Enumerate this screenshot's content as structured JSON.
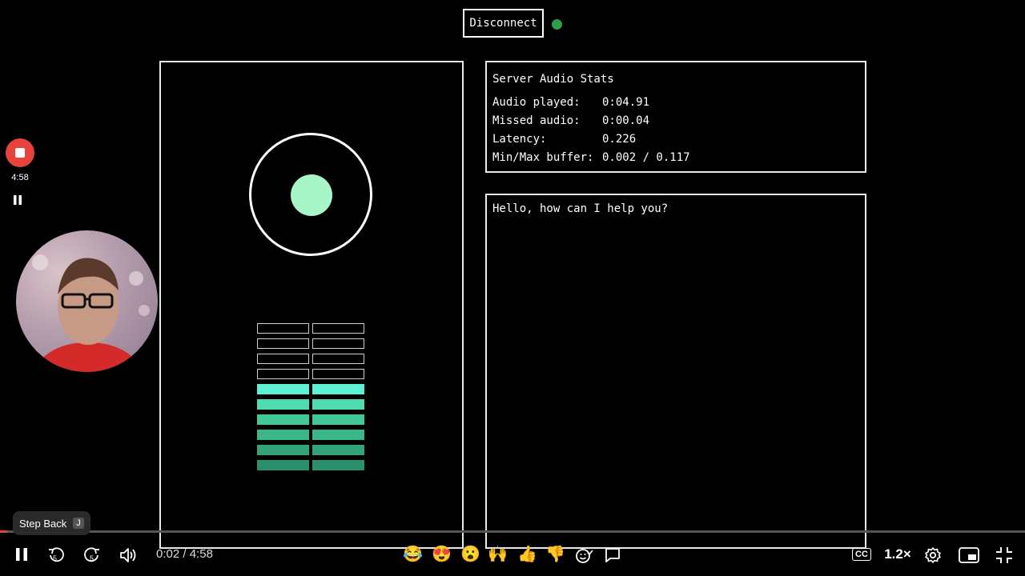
{
  "header": {
    "disconnect_label": "Disconnect",
    "status_color": "#2e9e48"
  },
  "stats": {
    "title": "Server Audio Stats",
    "rows": [
      {
        "label": "Audio played:",
        "value": "0:04.91"
      },
      {
        "label": "Missed audio:",
        "value": "0:00.04"
      },
      {
        "label": "Latency:",
        "value": "0.226"
      },
      {
        "label": "Min/Max buffer:",
        "value": "0.002 / 0.117"
      }
    ]
  },
  "chat": {
    "message": "Hello, how can I help you?"
  },
  "meter": {
    "rows": 10,
    "lit_rows_from_bottom": 6,
    "lit_colors": [
      "#2a8f6a",
      "#33a37a",
      "#3bb689",
      "#42c897",
      "#4fdcb0",
      "#5ef0d2"
    ]
  },
  "recorder": {
    "elapsed": "4:58",
    "stop_color": "#e8423c"
  },
  "player": {
    "tooltip_label": "Step Back",
    "tooltip_key": "J",
    "current_time": "0:02",
    "duration": "4:58",
    "time_separator": " / ",
    "progress_fraction": 0.007,
    "speed": "1.2×",
    "cc_label": "CC",
    "skip_back_seconds": "5",
    "skip_forward_seconds": "5",
    "reactions": [
      "😂",
      "😍",
      "😮",
      "🙌",
      "👍",
      "👎"
    ]
  }
}
